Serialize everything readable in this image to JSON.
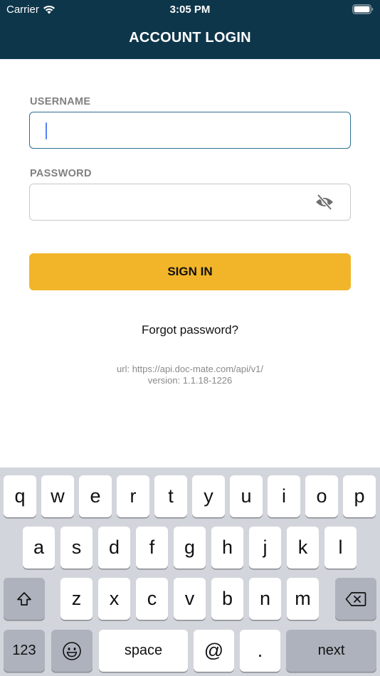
{
  "status_bar": {
    "carrier": "Carrier",
    "time": "3:05 PM",
    "wifi_icon": "wifi-icon",
    "battery_icon": "battery-full-icon"
  },
  "header": {
    "title": "ACCOUNT LOGIN",
    "background_color": "#0e364b"
  },
  "form": {
    "username": {
      "label": "USERNAME",
      "value": "",
      "placeholder": ""
    },
    "password": {
      "label": "PASSWORD",
      "value": "",
      "placeholder": "",
      "toggle_icon": "eye-slash-icon"
    },
    "sign_in_label": "SIGN IN",
    "sign_in_color": "#f2b52a",
    "forgot_password_label": "Forgot password?"
  },
  "footer_info": {
    "url_line": "url: https://api.doc-mate.com/api/v1/",
    "version_line": "version: 1.1.18-1226"
  },
  "keyboard": {
    "row1": [
      "q",
      "w",
      "e",
      "r",
      "t",
      "y",
      "u",
      "i",
      "o",
      "p"
    ],
    "row2": [
      "a",
      "s",
      "d",
      "f",
      "g",
      "h",
      "j",
      "k",
      "l"
    ],
    "row3": [
      "z",
      "x",
      "c",
      "v",
      "b",
      "n",
      "m"
    ],
    "shift_icon": "shift-icon",
    "delete_icon": "delete-backspace-icon",
    "numbers_label": "123",
    "emoji_icon": "emoji-icon",
    "space_label": "space",
    "at_label": "@",
    "dot_label": ".",
    "next_label": "next"
  }
}
